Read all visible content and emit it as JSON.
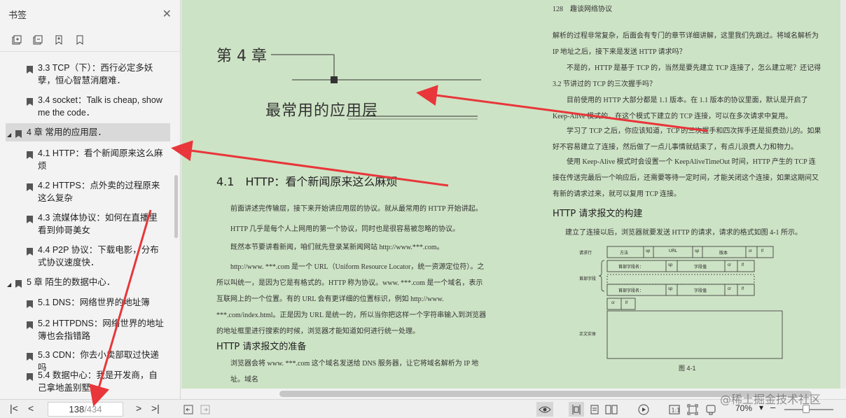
{
  "sidebar": {
    "title": "书签",
    "close_icon": "close-icon",
    "tools": [
      "expand-bookmark-icon",
      "collapse-bookmark-icon",
      "add-bookmark-icon",
      "bookmark-icon"
    ],
    "items": [
      {
        "label": "3.3 TCP（下）：西行必定多妖孽，恒心智慧消磨难．"
      },
      {
        "label": "3.4 socket：Talk is cheap, show me the code．"
      },
      {
        "label": "4 章 常用的应用层．"
      },
      {
        "label": "4.1 HTTP：看个新闻原来这么麻烦"
      },
      {
        "label": "4.2 HTTPS：点外卖的过程原来这么复杂"
      },
      {
        "label": "4.3 流媒体协议：如何在直播里看到帅哥美女"
      },
      {
        "label": "4.4 P2P 协议：下载电影，分布式协议速度快．"
      },
      {
        "label": "5 章 陌生的数据中心．"
      },
      {
        "label": "5.1 DNS：网络世界的地址簿"
      },
      {
        "label": "5.2 HTTPDNS：网络世界的地址簿也会指错路"
      },
      {
        "label": "5.3 CDN：你去小卖部取过快递吗"
      },
      {
        "label": "5.4 数据中心：我是开发商，自己拿地盖别墅"
      }
    ]
  },
  "page": {
    "running_head": "128　趣谈网络协议",
    "chapter_number": "第 4 章",
    "chapter_title": "最常用的应用层",
    "section_title": "4.1　HTTP：看个新闻原来这么麻烦",
    "left_paras": [
      "前面讲述完传输层，接下来开始讲应用层的协议。就从最常用的 HTTP 开始讲起。",
      "HTTP 几乎是每个人上网用的第一个协议，同时也是很容易被忽略的协议。",
      "既然本节要讲看新闻，咱们就先登录某新闻网站 http://www.***.com。",
      "http://www. ***.com 是一个 URL（Uniform Resource Locator，统一资源定位符）。之所以叫统一，是因为它是有格式的。HTTP 称为协议。www. ***.com 是一个域名，表示互联网上的一个位置。有的 URL 会有更详细的位置标识，例如 http://www. ***.com/index.html。正是因为 URL 是统一的，所以当你把这样一个字符串输入到浏览器的地址框里进行搜索的时候，浏览器才能知道如何进行统一处理。"
    ],
    "left_subtitle": "HTTP 请求报文的准备",
    "left_last_para": "浏览器会将 www. ***.com 这个域名发送给 DNS 服务器，让它将域名解析为 IP 地址。域名",
    "right_paras": [
      "解析的过程非常复杂，后面会有专门的章节详细讲解，这里我们先跳过。将域名解析为 IP 地址之后，接下来是发送 HTTP 请求吗？",
      "不是的，HTTP 是基于 TCP 的，当然是要先建立 TCP 连接了，怎么建立呢？还记得 3.2 节讲过的 TCP 的三次握手吗？",
      "目前使用的 HTTP 大部分都是 1.1 版本。在 1.1 版本的协议里面，默认是开启了 Keep-Alive 模式的，在这个模式下建立的 TCP 连接，可以在多次请求中复用。",
      "学习了 TCP 之后，你应该知道，TCP 的三次握手和四次挥手还是挺费劲儿的。如果好不容易建立了连接，然后做了一点儿事情就结束了，有点儿浪费人力和物力。",
      "使用 Keep-Alive 模式时会设置一个 KeepAliveTimeOut 时间，HTTP 产生的 TCP 连接在传送完最后一个响应后，还需要等待一定时间，才能关闭这个连接，如果这期间又有新的请求过来，就可以复用 TCP 连接。"
    ],
    "right_subtitle": "HTTP 请求报文的构建",
    "right_last_para": "建立了连接以后，浏览器就要发送 HTTP 的请求，请求的格式如图 4-1 所示。",
    "figure": {
      "request_line_label": "请求行",
      "header_label": "首部字段",
      "body_label": "正文实体",
      "request_line": [
        "方法",
        "sp",
        "URL",
        "sp",
        "版本",
        "cr",
        "lf"
      ],
      "header_row": [
        "首部字段名：",
        "sp",
        "字段值",
        "cr",
        "lf"
      ],
      "end_row": [
        "cr",
        "lf"
      ],
      "caption": "图 4-1"
    }
  },
  "bottombar": {
    "current_page": "138",
    "total_pages": "/434",
    "zoom": "70%",
    "zoom_minus": "–"
  },
  "watermark": "@稀土掘金技术社区",
  "colors": {
    "page_bg": "#cde3c5",
    "arrow": "#e8363a",
    "sidebar_bg": "#f3f3f3"
  }
}
